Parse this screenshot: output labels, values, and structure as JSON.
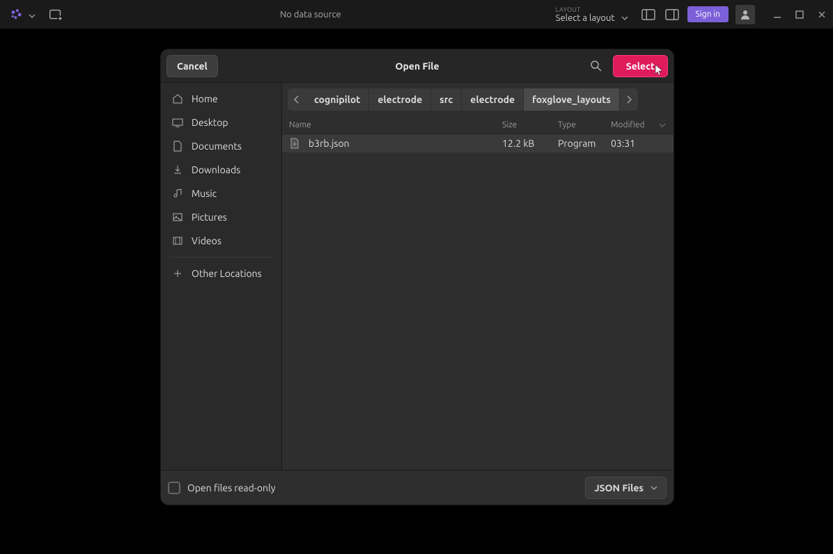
{
  "topbar": {
    "no_data": "No data source",
    "layout_label": "LAYOUT",
    "layout_value": "Select a layout",
    "signin": "Sign in"
  },
  "dialog": {
    "cancel": "Cancel",
    "title": "Open File",
    "select": "Select"
  },
  "sidebar": {
    "home": "Home",
    "desktop": "Desktop",
    "documents": "Documents",
    "downloads": "Downloads",
    "music": "Music",
    "pictures": "Pictures",
    "videos": "Videos",
    "other": "Other Locations"
  },
  "breadcrumb": {
    "items": [
      "cognipilot",
      "electrode",
      "src",
      "electrode",
      "foxglove_layouts"
    ]
  },
  "table": {
    "headers": {
      "name": "Name",
      "size": "Size",
      "type": "Type",
      "modified": "Modified"
    },
    "rows": [
      {
        "name": "b3rb.json",
        "size": "12.2 kB",
        "type": "Program",
        "modified": "03:31"
      }
    ]
  },
  "footer": {
    "readonly": "Open files read-only",
    "filetype": "JSON Files"
  }
}
